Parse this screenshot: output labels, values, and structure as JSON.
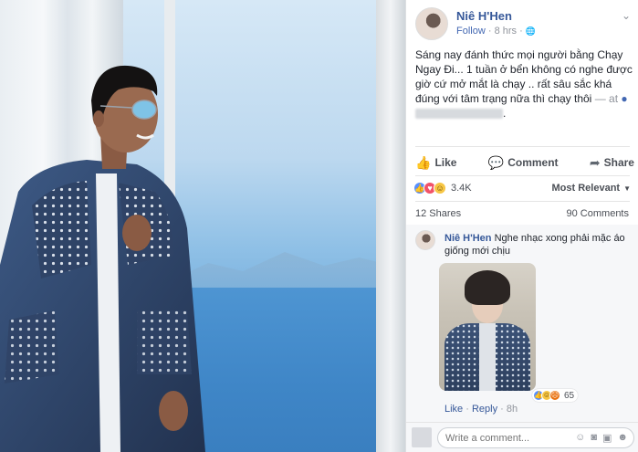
{
  "post": {
    "author": "Niê H'Hen",
    "follow_label": "Follow",
    "time": "8 hrs",
    "globe": "🌐",
    "text": "Sáng nay đánh thức mọi người bằng Chạy Ngay Đi... 1 tuần ở bển không có nghe được giờ cứ mở mắt là chạy .. rất sâu sắc khá đúng với tâm trạng nữa thì chạy thôi",
    "at_label": "— at"
  },
  "actions": {
    "like_label": "Like",
    "comment_label": "Comment",
    "share_label": "Share"
  },
  "reactions": {
    "count": "3.4K",
    "sort_label": "Most Relevant",
    "shares_label": "12 Shares",
    "comments_label": "90 Comments"
  },
  "comment": {
    "author": "Niê H'Hen",
    "text": "Nghe nhạc xong phải mặc áo giống mới chịu",
    "reaction_count": "65",
    "like_label": "Like",
    "reply_label": "Reply",
    "time": "8h"
  },
  "comment_input": {
    "placeholder": "Write a comment..."
  },
  "colors": {
    "link": "#365899",
    "facebook_blue": "#4267b2",
    "like": "#5890ff",
    "love": "#f25268"
  }
}
